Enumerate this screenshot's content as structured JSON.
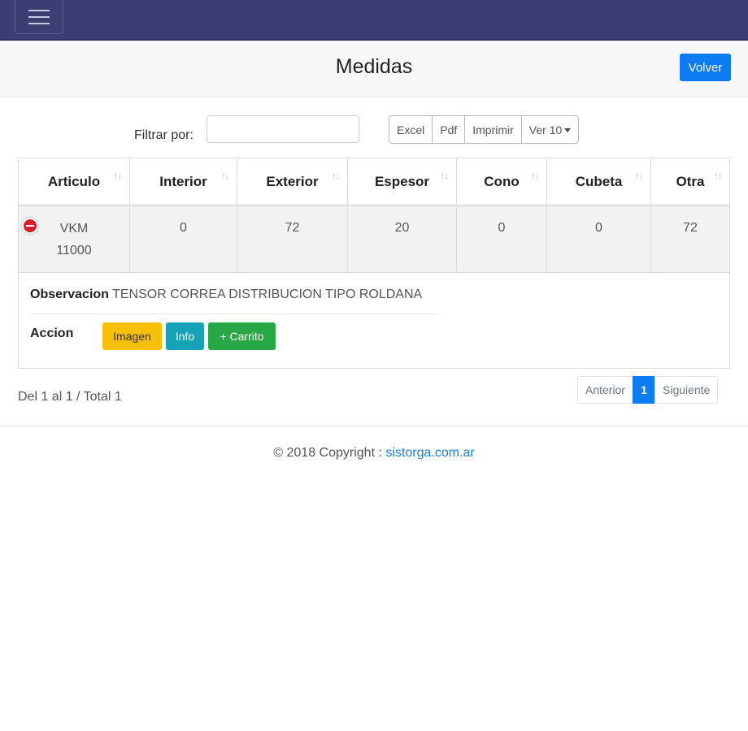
{
  "header": {
    "menu_icon": "hamburger-icon"
  },
  "titlebar": {
    "title": "Medidas",
    "back_label": "Volver"
  },
  "filter": {
    "label": "Filtrar por:",
    "value": "",
    "placeholder": ""
  },
  "export_buttons": [
    "Excel",
    "Pdf",
    "Imprimir"
  ],
  "page_size": {
    "label": "Ver 10",
    "selected": "10"
  },
  "table": {
    "columns": [
      "Articulo",
      "Interior",
      "Exterior",
      "Espesor",
      "Cono",
      "Cubeta",
      "Otra"
    ],
    "rows": [
      {
        "articulo_line1": "VKM",
        "articulo_line2": "11000",
        "interior": "0",
        "exterior": "72",
        "espesor": "20",
        "cono": "0",
        "cubeta": "0",
        "otra": "72"
      }
    ]
  },
  "details": {
    "obs_label": "Observacion",
    "obs_value": "TENSOR CORREA DISTRIBUCION TIPO ROLDANA",
    "accion_label": "Accion",
    "btn_imagen": "Imagen",
    "btn_info": "Info",
    "btn_carrito": "+ Carrito"
  },
  "pager": {
    "info": "Del 1 al 1 / Total 1",
    "prev": "Anterior",
    "current": "1",
    "next": "Siguiente"
  },
  "footer": {
    "copyright": "© 2018 Copyright :",
    "link": "sistorga.com.ar"
  },
  "colors": {
    "navbar": "#3d3d74",
    "primary": "#0d7cf2",
    "warning": "#f8bf07",
    "info": "#18a2b8",
    "success": "#28a745",
    "danger": "#d9202a"
  }
}
